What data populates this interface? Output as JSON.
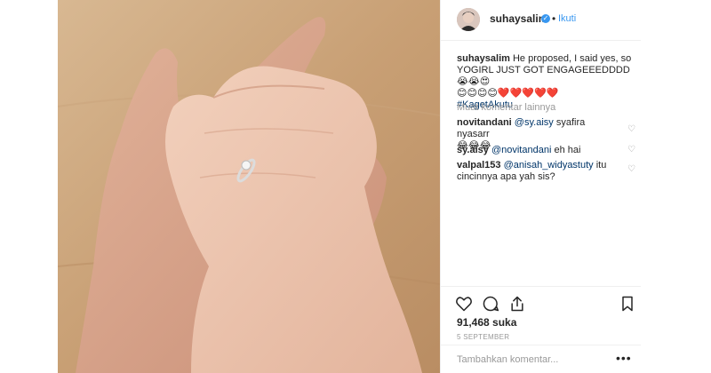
{
  "post": {
    "username": "suhaysalim",
    "follow_label": "Ikuti",
    "separator": "•",
    "caption": {
      "user": "suhaysalim",
      "line1": "He proposed, I said yes, so",
      "line2": "YOGIRL JUST GOT ENGAGEEEDDDD 😭😭😍",
      "line3": "😊😊😊😊❤️❤️❤️❤️❤️",
      "hashtag": "#KagetAkutu"
    },
    "load_more": "Muat komentar lainnya",
    "comments": [
      {
        "user": "novitandani",
        "mention": "@sy.aisy",
        "text": "syafira nyasarr",
        "text2": "😂😂😂"
      },
      {
        "user": "sy.aisy",
        "mention": "@novitandani",
        "text": "eh hai",
        "text2": ""
      },
      {
        "user": "valpal153",
        "mention": "@anisah_widyastuty",
        "text": "itu",
        "text2": "cincinnya apa yah sis?"
      }
    ],
    "likes": "91,468 suka",
    "date": "5 SEPTEMBER",
    "add_comment_placeholder": "Tambahkan komentar...",
    "more_options": "•••",
    "icons": {
      "verified": "verified-badge-icon",
      "like": "heart-outline-icon",
      "comment": "speech-bubble-icon",
      "share": "share-icon",
      "save": "bookmark-icon"
    },
    "colors": {
      "link": "#3897f0",
      "hashtag": "#003569",
      "muted": "#999999",
      "text": "#262626"
    }
  }
}
